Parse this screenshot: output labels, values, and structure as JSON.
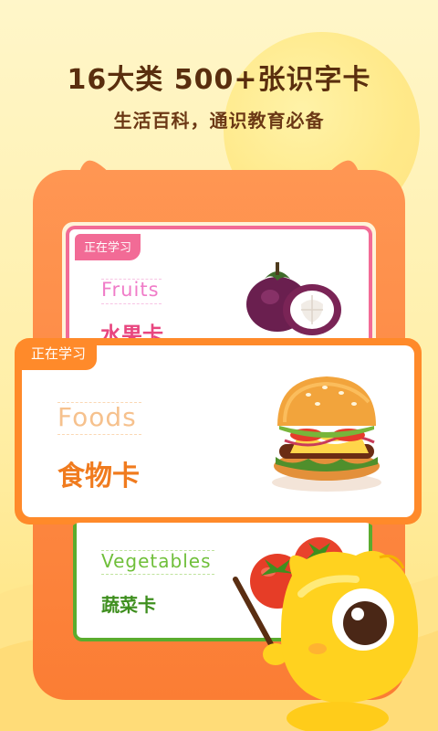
{
  "header": {
    "title": "16大类 500+张识字卡",
    "subtitle": "生活百科，通识教育必备"
  },
  "cards": [
    {
      "tag": "正在学习",
      "english": "Fruits",
      "chinese": "水果卡",
      "image": "mangosteen-image",
      "accent": "#f26b96"
    },
    {
      "tag": "正在学习",
      "english": "Foods",
      "chinese": "食物卡",
      "image": "hamburger-image",
      "accent": "#ff8a2a"
    },
    {
      "tag": "",
      "english": "Vegetables",
      "chinese": "蔬菜卡",
      "image": "tomato-image",
      "accent": "#5aac2e"
    }
  ],
  "colors": {
    "background": "#fff3b8",
    "device": "#fb8a40",
    "fruits_accent": "#f26b96",
    "foods_accent": "#ff8a2a",
    "vegetables_accent": "#5aac2e"
  }
}
